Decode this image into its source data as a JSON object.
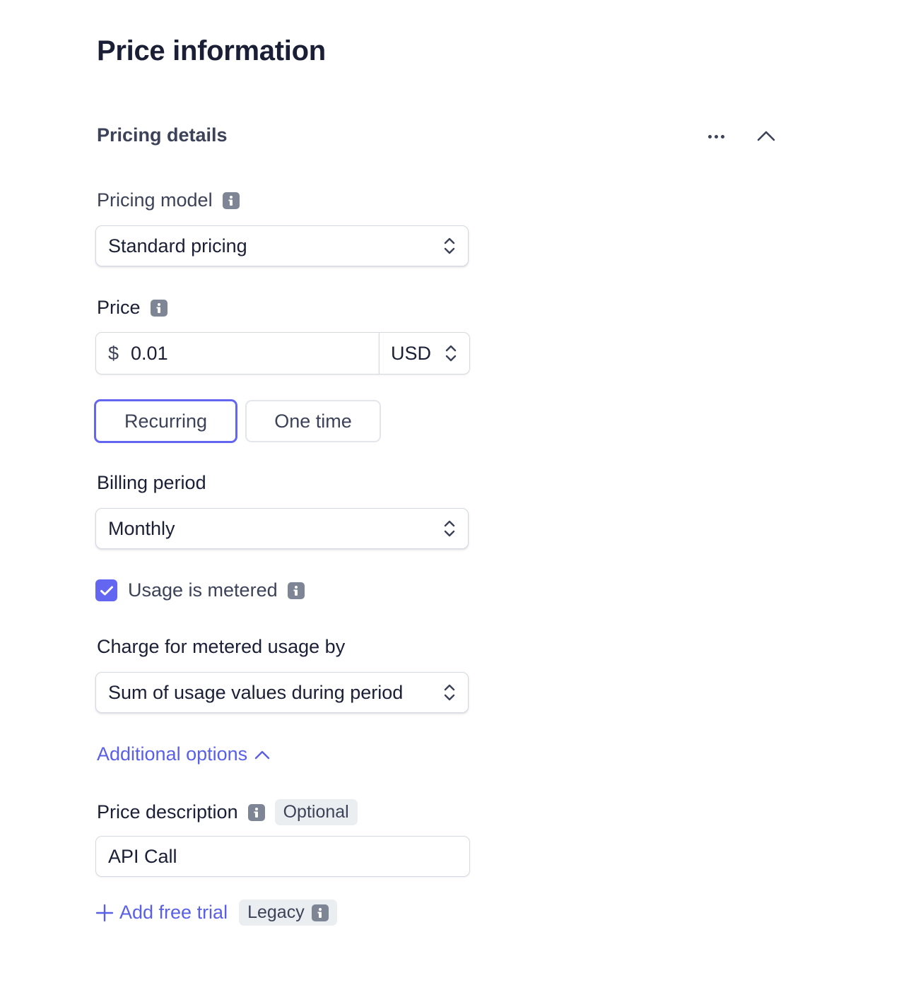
{
  "page": {
    "title": "Price information"
  },
  "section": {
    "title": "Pricing details"
  },
  "pricing_model": {
    "label": "Pricing model",
    "value": "Standard pricing"
  },
  "price": {
    "label": "Price",
    "currency_symbol": "$",
    "value": "0.01",
    "currency": "USD"
  },
  "type_toggle": {
    "options": [
      "Recurring",
      "One time"
    ],
    "selected": "Recurring"
  },
  "billing_period": {
    "label": "Billing period",
    "value": "Monthly"
  },
  "metered": {
    "label": "Usage is metered",
    "checked": true
  },
  "charge_by": {
    "label": "Charge for metered usage by",
    "value": "Sum of usage values during period"
  },
  "additional_options": {
    "label": "Additional options",
    "expanded": true
  },
  "price_description": {
    "label": "Price description",
    "badge": "Optional",
    "value": "API Call"
  },
  "free_trial": {
    "link": "Add free trial",
    "badge": "Legacy"
  },
  "colors": {
    "accent": "#6366f1",
    "link": "#5a5fe8",
    "text": "#1a1f36",
    "muted": "#3c4257",
    "info_icon": "#7e8595"
  },
  "icons": [
    "more-icon",
    "chevron-up-icon",
    "info-icon",
    "chevron-up-down-icon",
    "check-icon",
    "plus-icon"
  ]
}
